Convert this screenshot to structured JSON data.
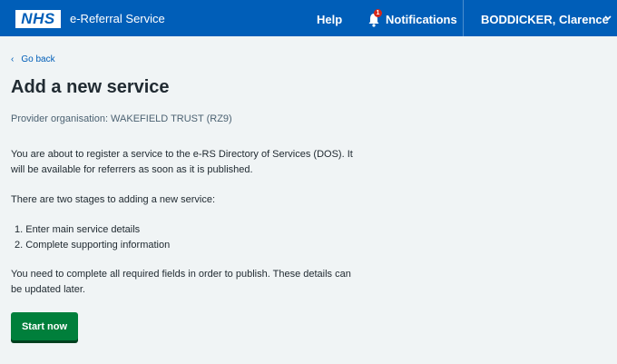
{
  "header": {
    "logo": "NHS",
    "service_name": "e-Referral Service",
    "help_label": "Help",
    "notifications_label": "Notifications",
    "notification_count": "1",
    "user_name": "BODDICKER, Clarence"
  },
  "nav": {
    "back_label": "Go back"
  },
  "main": {
    "title": "Add a new service",
    "provider": "Provider organisation: WAKEFIELD TRUST (RZ9)",
    "intro": "You are about to register a service to the e-RS Directory of Services (DOS). It will be available for referrers as soon as it is published.",
    "stages_intro": "There are two stages to adding a new service:",
    "steps": [
      "1. Enter main service details",
      "2. Complete supporting information"
    ],
    "outro": "You need to complete all required fields in order to publish. These details can be updated later.",
    "start_button": "Start now"
  },
  "colors": {
    "brand_blue": "#005eb8",
    "button_green": "#007f3b",
    "background": "#f0f4f5"
  }
}
